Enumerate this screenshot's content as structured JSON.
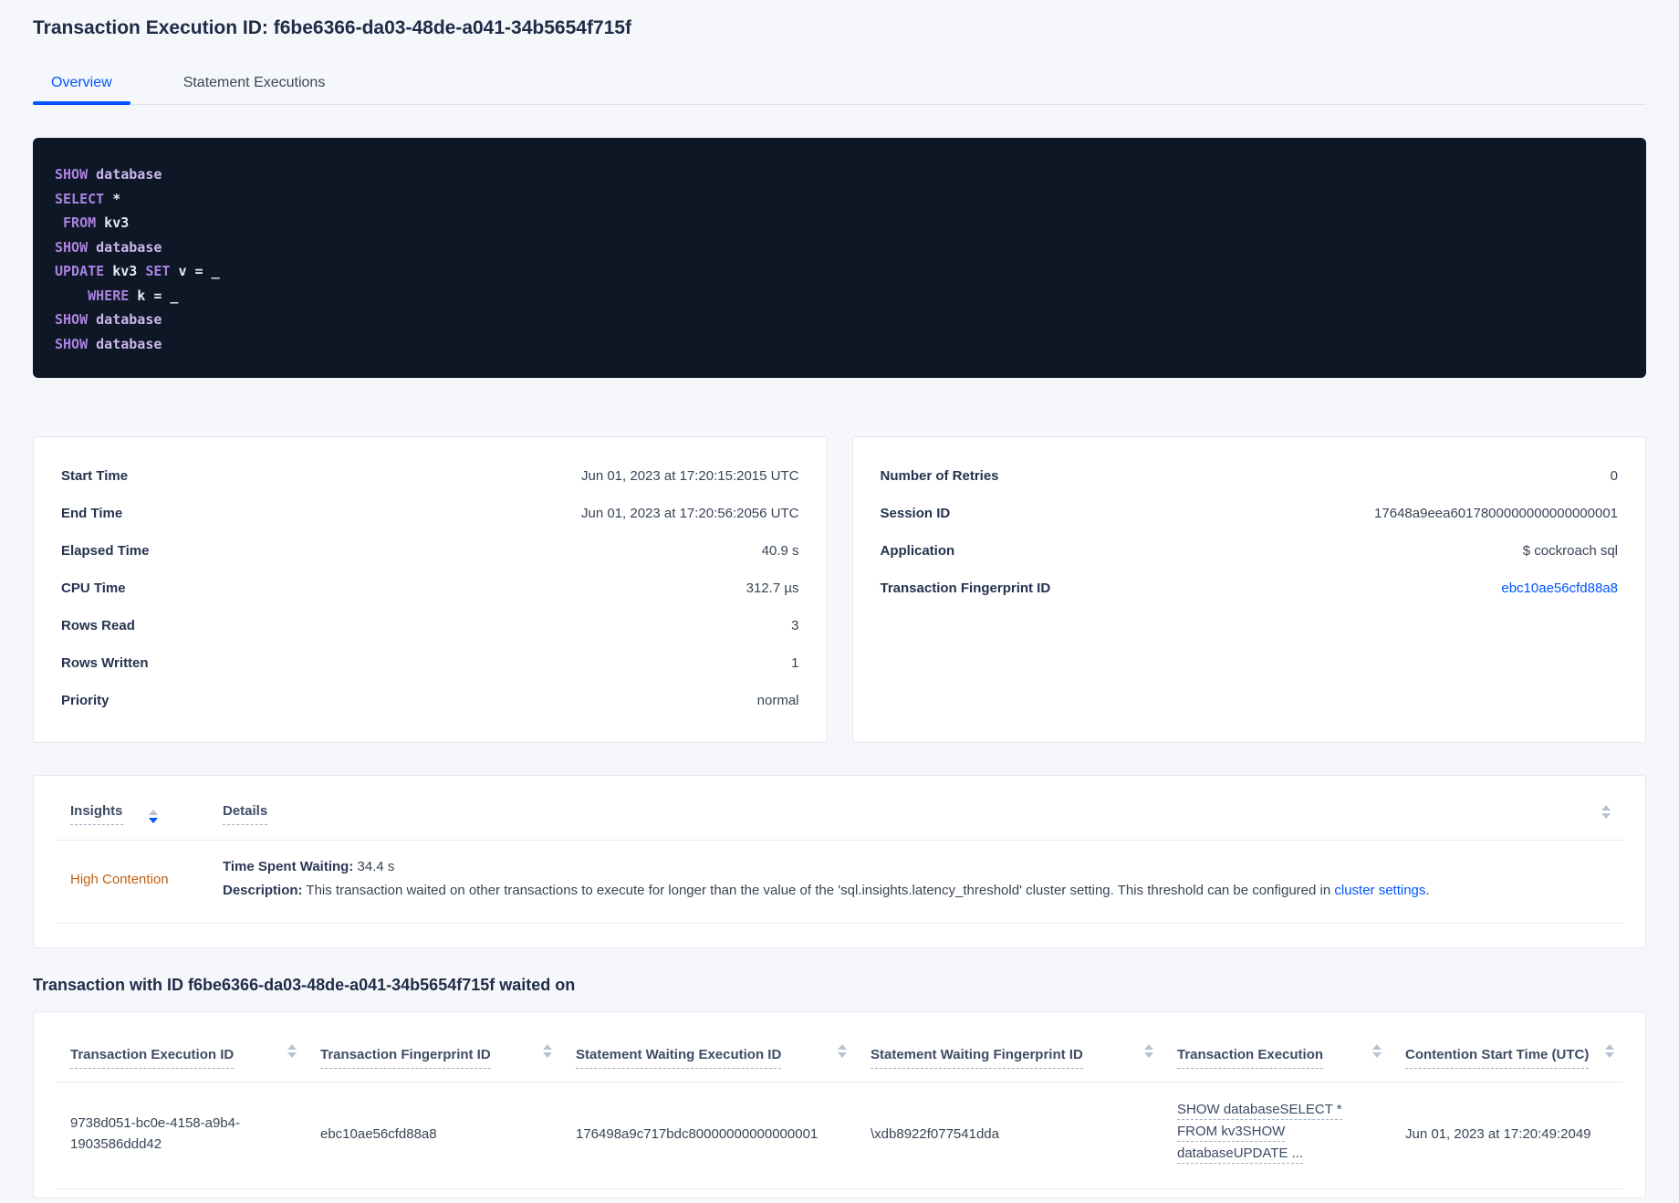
{
  "header": {
    "title": "Transaction Execution ID: f6be6366-da03-48de-a041-34b5654f715f",
    "tabs": [
      {
        "label": "Overview",
        "active": true
      },
      {
        "label": "Statement Executions",
        "active": false
      }
    ]
  },
  "sql_box": {
    "lines": [
      [
        {
          "text": "SHOW",
          "type": "kw"
        },
        {
          "text": " database",
          "type": "kw2"
        }
      ],
      [
        {
          "text": "SELECT",
          "type": "kw"
        },
        {
          "text": " *",
          "type": "id"
        }
      ],
      [
        {
          "text": " ",
          "type": "id"
        },
        {
          "text": "FROM",
          "type": "kw"
        },
        {
          "text": " kv3",
          "type": "id"
        }
      ],
      [
        {
          "text": "SHOW",
          "type": "kw"
        },
        {
          "text": " database",
          "type": "kw2"
        }
      ],
      [
        {
          "text": "UPDATE",
          "type": "kw"
        },
        {
          "text": " kv3 ",
          "type": "id"
        },
        {
          "text": "SET",
          "type": "kw"
        },
        {
          "text": " v = _",
          "type": "id"
        }
      ],
      [
        {
          "text": "    ",
          "type": "id"
        },
        {
          "text": "WHERE",
          "type": "kw"
        },
        {
          "text": " k = _",
          "type": "id"
        }
      ],
      [
        {
          "text": "SHOW",
          "type": "kw"
        },
        {
          "text": " database",
          "type": "kw2"
        }
      ],
      [
        {
          "text": "SHOW",
          "type": "kw"
        },
        {
          "text": " database",
          "type": "kw2"
        }
      ]
    ]
  },
  "details_left": {
    "rows": [
      {
        "label": "Start Time",
        "value": "Jun 01, 2023 at 17:20:15:2015 UTC"
      },
      {
        "label": "End Time",
        "value": "Jun 01, 2023 at 17:20:56:2056 UTC"
      },
      {
        "label": "Elapsed Time",
        "value": "40.9 s"
      },
      {
        "label": "CPU Time",
        "value": "312.7 µs"
      },
      {
        "label": "Rows Read",
        "value": "3"
      },
      {
        "label": "Rows Written",
        "value": "1"
      },
      {
        "label": "Priority",
        "value": "normal"
      }
    ]
  },
  "details_right": {
    "rows": [
      {
        "label": "Number of Retries",
        "value": "0"
      },
      {
        "label": "Session ID",
        "value": "17648a9eea6017800000000000000001"
      },
      {
        "label": "Application",
        "value": "$ cockroach sql"
      },
      {
        "label": "Transaction Fingerprint ID",
        "value": "ebc10ae56cfd88a8",
        "link": true
      }
    ]
  },
  "insights": {
    "columns": [
      "Insights",
      "Details"
    ],
    "row": {
      "insight": "High Contention",
      "waiting_label": "Time Spent Waiting:",
      "waiting_value": " 34.4 s",
      "description_label": "Description:",
      "description_text": " This transaction waited on other transactions to execute for longer than the value of the 'sql.insights.latency_threshold' cluster setting. This threshold can be configured in ",
      "description_link": "cluster settings",
      "description_suffix": "."
    }
  },
  "waited_on": {
    "title": "Transaction with ID f6be6366-da03-48de-a041-34b5654f715f waited on",
    "columns": [
      "Transaction Execution ID",
      "Transaction Fingerprint ID",
      "Statement Waiting Execution ID",
      "Statement Waiting Fingerprint ID",
      "Transaction Execution",
      "Contention Start Time (UTC)"
    ],
    "row": {
      "transaction_execution_id": "9738d051-bc0e-4158-a9b4-1903586ddd42",
      "transaction_fingerprint_id": "ebc10ae56cfd88a8",
      "statement_waiting_execution_id": "176498a9c717bdc80000000000000001",
      "statement_waiting_fingerprint_id": "\\xdb8922f077541dda",
      "transaction_execution_lines": [
        "SHOW databaseSELECT *",
        "FROM kv3SHOW",
        "databaseUPDATE ..."
      ],
      "contention_start_time": "Jun 01, 2023 at 17:20:49:2049"
    }
  },
  "colors": {
    "accent_blue": "#0055ff",
    "insight_orange": "#bf6113",
    "sql_background": "#0e1726",
    "sql_keyword": "#ab82e0",
    "sql_keyword_secondary": "#c9b7ee",
    "sql_identifier": "#e7e9f6"
  }
}
